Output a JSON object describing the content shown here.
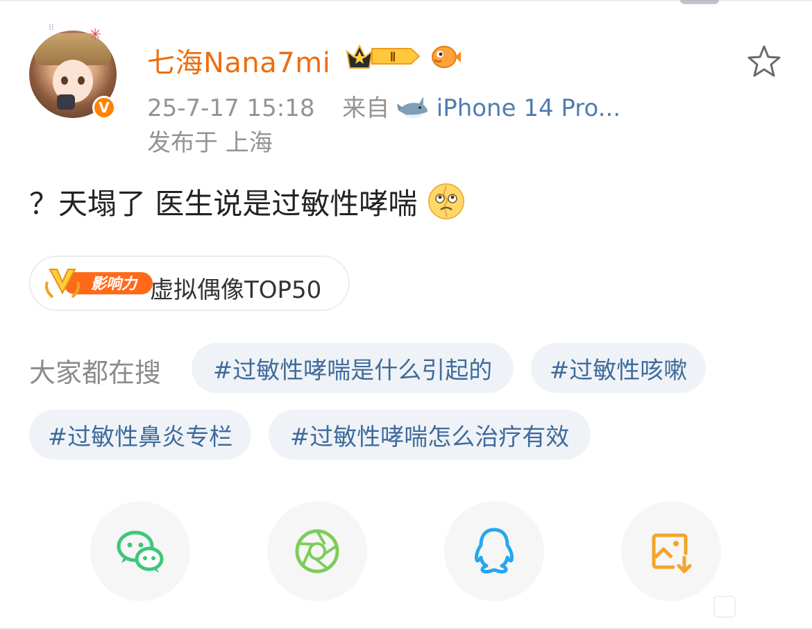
{
  "post": {
    "username": "七海Nana7mi",
    "crown_level": "Ⅱ",
    "timestamp": "25-7-17 15:18",
    "source_prefix": "来自",
    "source_device": "iPhone 14 Pro...",
    "location": "发布于 上海",
    "verified_mark": "V",
    "content": "？天塌了 医生说是过敏性哮喘"
  },
  "influence_tag": {
    "badge_text": "影响力",
    "label": "虚拟偶像TOP50"
  },
  "search": {
    "label": "大家都在搜",
    "chips": [
      "#过敏性哮喘是什么引起的",
      "#过敏性咳嗽",
      "#过敏性鼻炎专栏",
      "#过敏性哮喘怎么治疗有效"
    ]
  },
  "share": {
    "icons": [
      "wechat-icon",
      "moments-icon",
      "qq-icon",
      "save-image-icon"
    ]
  },
  "colors": {
    "username": "#ee6d0f",
    "link": "#507daf",
    "chip_text": "#3f6b9b",
    "chip_bg": "#eff3f7",
    "wechat": "#3fc67c",
    "moments": "#7ccd5a",
    "qq": "#26a6f0",
    "save": "#f3a52a"
  }
}
